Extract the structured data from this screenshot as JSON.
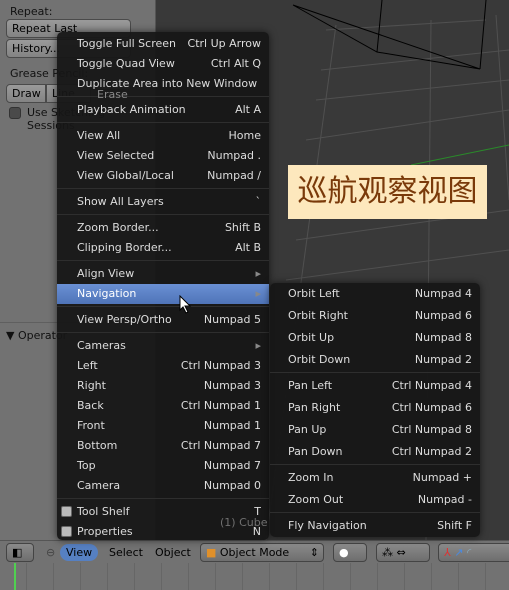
{
  "left_panel": {
    "repeat_label": "Repeat:",
    "repeat_last": "Repeat Last",
    "history": "History...",
    "grease_pencil": "Grease Pencil:",
    "draw": "Draw",
    "line": "Line",
    "erase": "Erase",
    "use_sketching": "Use Sketching Sessions",
    "operator": "Operator"
  },
  "view_menu": {
    "items": [
      {
        "label": "Toggle Full Screen",
        "shortcut": "Ctrl Up Arrow"
      },
      {
        "label": "Toggle Quad View",
        "shortcut": "Ctrl Alt Q"
      },
      {
        "label": "Duplicate Area into New Window",
        "shortcut": ""
      },
      {
        "label": "Playback Animation",
        "shortcut": "Alt A"
      },
      {
        "label": "View All",
        "shortcut": "Home"
      },
      {
        "label": "View Selected",
        "shortcut": "Numpad ."
      },
      {
        "label": "View Global/Local",
        "shortcut": "Numpad /"
      },
      {
        "label": "Show All Layers",
        "shortcut": "`"
      },
      {
        "label": "Zoom Border...",
        "shortcut": "Shift B"
      },
      {
        "label": "Clipping Border...",
        "shortcut": "Alt B"
      },
      {
        "label": "Align View",
        "shortcut": "▸"
      },
      {
        "label": "Navigation",
        "shortcut": "▸"
      },
      {
        "label": "View Persp/Ortho",
        "shortcut": "Numpad 5"
      },
      {
        "label": "Cameras",
        "shortcut": "▸"
      },
      {
        "label": "Left",
        "shortcut": "Ctrl Numpad 3"
      },
      {
        "label": "Right",
        "shortcut": "Numpad 3"
      },
      {
        "label": "Back",
        "shortcut": "Ctrl Numpad 1"
      },
      {
        "label": "Front",
        "shortcut": "Numpad 1"
      },
      {
        "label": "Bottom",
        "shortcut": "Ctrl Numpad 7"
      },
      {
        "label": "Top",
        "shortcut": "Numpad 7"
      },
      {
        "label": "Camera",
        "shortcut": "Numpad 0"
      },
      {
        "label": "Tool Shelf",
        "shortcut": "T"
      },
      {
        "label": "Properties",
        "shortcut": "N"
      }
    ],
    "highlighted": "Navigation"
  },
  "navigation_menu": {
    "items": [
      {
        "label": "Orbit Left",
        "shortcut": "Numpad 4"
      },
      {
        "label": "Orbit Right",
        "shortcut": "Numpad 6"
      },
      {
        "label": "Orbit Up",
        "shortcut": "Numpad 8"
      },
      {
        "label": "Orbit Down",
        "shortcut": "Numpad 2"
      },
      {
        "label": "Pan Left",
        "shortcut": "Ctrl Numpad 4"
      },
      {
        "label": "Pan Right",
        "shortcut": "Ctrl Numpad 6"
      },
      {
        "label": "Pan Up",
        "shortcut": "Ctrl Numpad 8"
      },
      {
        "label": "Pan Down",
        "shortcut": "Ctrl Numpad 2"
      },
      {
        "label": "Zoom In",
        "shortcut": "Numpad +"
      },
      {
        "label": "Zoom Out",
        "shortcut": "Numpad -"
      },
      {
        "label": "Fly Navigation",
        "shortcut": "Shift F"
      }
    ]
  },
  "viewport": {
    "object_label": "(1) Cube",
    "caption": "巡航观察视图"
  },
  "header": {
    "view": "View",
    "select": "Select",
    "object": "Object",
    "mode": "Object Mode"
  },
  "colors": {
    "highlight": "#5680c2",
    "caption_bg": "#fde8bd",
    "caption_text": "#7a3a0a"
  }
}
